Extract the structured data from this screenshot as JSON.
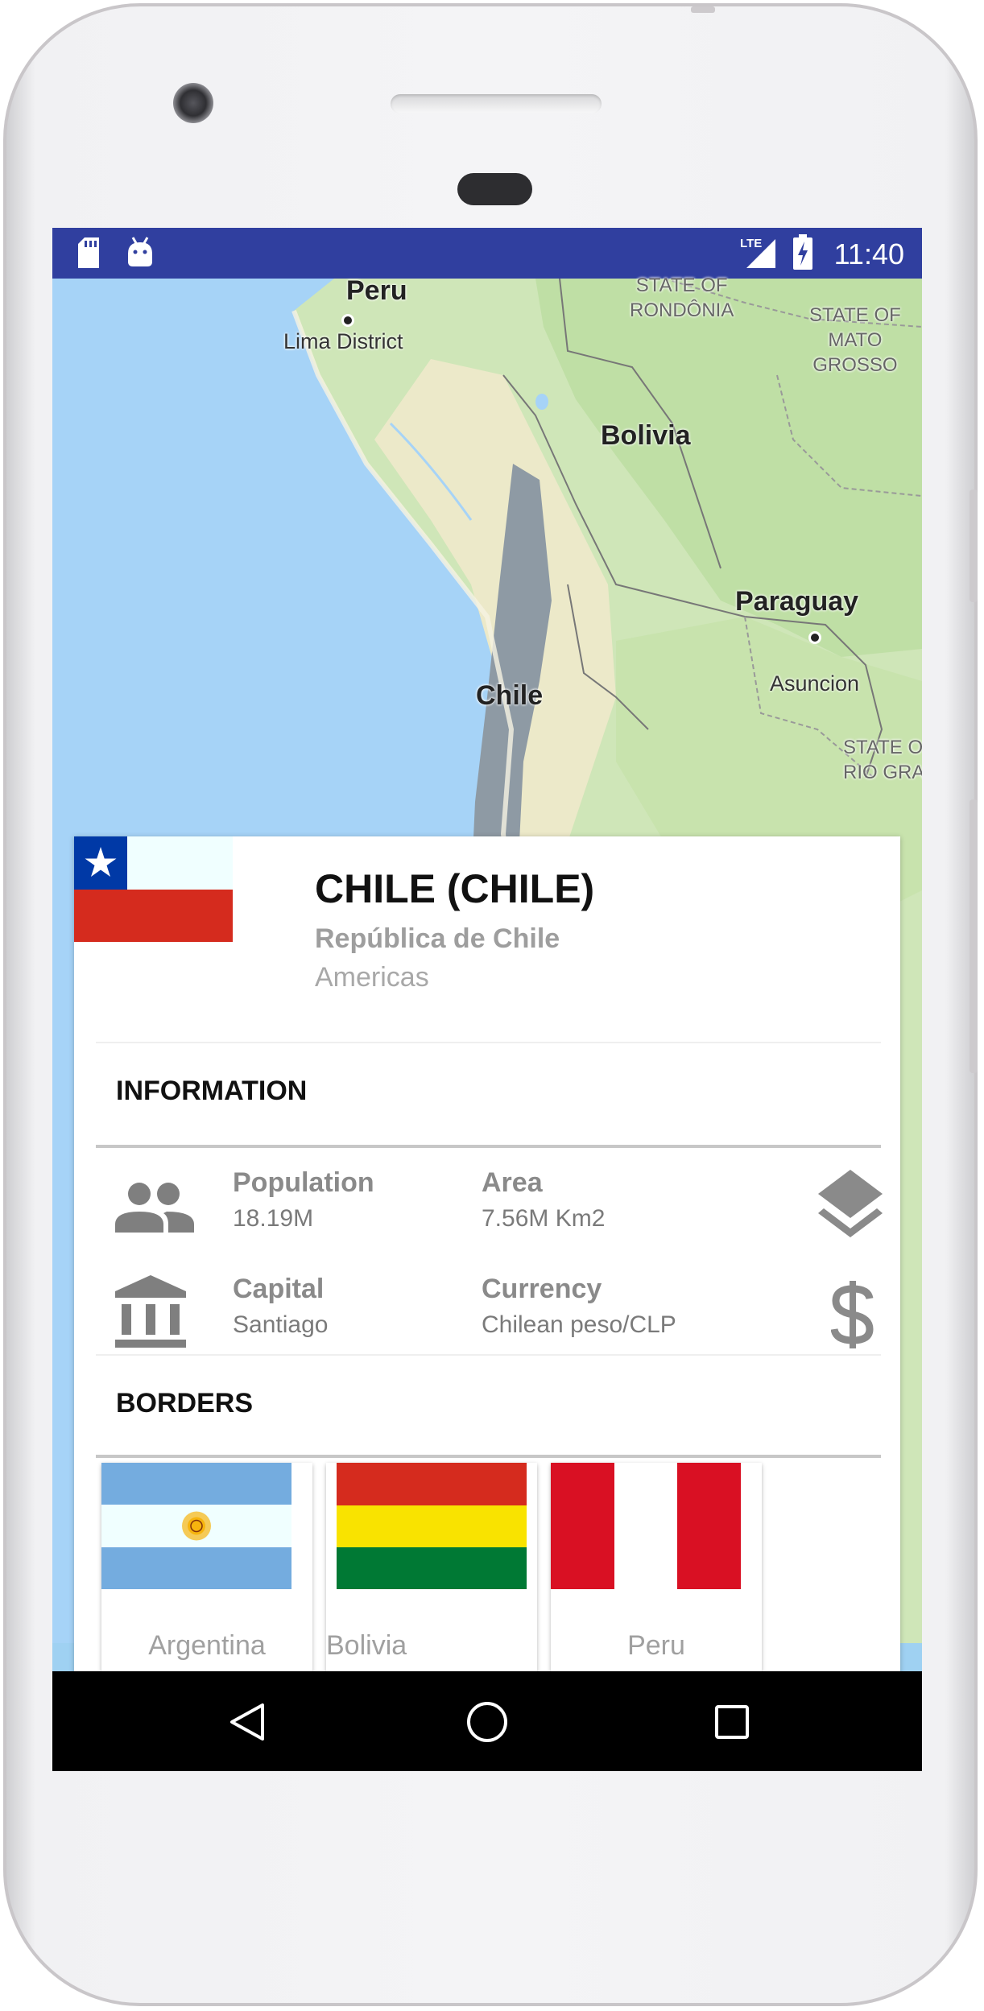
{
  "status_bar": {
    "time": "11:40",
    "network": "LTE"
  },
  "map": {
    "labels": {
      "peru": "Peru",
      "lima": "Lima District",
      "rondonia": [
        "STATE OF",
        "RONDÔNIA"
      ],
      "mato_grosso": [
        "STATE OF",
        "MATO",
        "GROSSO"
      ],
      "bolivia": "Bolivia",
      "paraguay": "Paraguay",
      "asuncion": "Asuncion",
      "chile": "Chile",
      "rio_grande": [
        "STATE O",
        "RIO GRAN"
      ]
    }
  },
  "country": {
    "title": "CHILE (CHILE)",
    "native_name": "República de Chile",
    "region": "Americas",
    "flag": "chile-flag"
  },
  "information": {
    "section_title": "INFORMATION",
    "population": {
      "label": "Population",
      "value": "18.19M",
      "icon": "people-icon"
    },
    "area": {
      "label": "Area",
      "value": "7.56M Km2",
      "icon": "layers-icon"
    },
    "capital": {
      "label": "Capital",
      "value": "Santiago",
      "icon": "institution-icon"
    },
    "currency": {
      "label": "Currency",
      "value": "Chilean peso/CLP",
      "icon": "dollar-icon"
    }
  },
  "borders": {
    "section_title": "BORDERS",
    "items": [
      {
        "name": "Argentina",
        "flag": "argentina-flag"
      },
      {
        "name": "Bolivia",
        "flag": "bolivia-flag"
      },
      {
        "name": "Peru",
        "flag": "peru-flag"
      }
    ]
  },
  "colors": {
    "status_bar": "#303f9f",
    "ocean": "#a6d3f7",
    "land": "#cfe6b8"
  }
}
